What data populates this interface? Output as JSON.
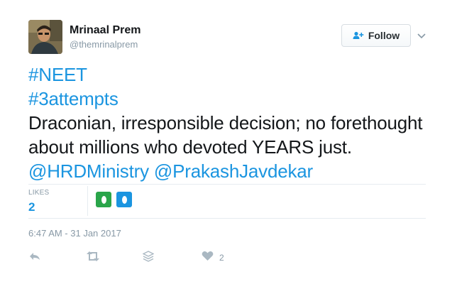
{
  "author": {
    "name": "Mrinaal Prem",
    "handle": "@themrinalprem",
    "avatar_icon": "user-avatar-photo"
  },
  "follow_button": {
    "label": "Follow",
    "icon": "add-user-icon"
  },
  "tweet": {
    "hashtag_1": "#NEET",
    "hashtag_2": "#3attempts",
    "text_line_1": "Draconian, irresponsible decision; no forethought",
    "text_line_2": "about millions who devoted YEARS just.",
    "mention_1": "@HRDMinistry",
    "mention_2": "@PrakashJavdekar"
  },
  "stats": {
    "likes_label": "LIKES",
    "likes_count": "2",
    "likers": [
      {
        "icon": "default-egg-avatar",
        "color": "#2aa54a"
      },
      {
        "icon": "default-egg-avatar",
        "color": "#1b95e0"
      }
    ]
  },
  "timestamp": "6:47 AM - 31 Jan 2017",
  "actions": {
    "reply_icon": "reply-icon",
    "retweet_icon": "retweet-icon",
    "more_icon": "layers-icon",
    "like_icon": "heart-icon",
    "like_count": "2"
  },
  "colors": {
    "link": "#1b95e0",
    "muted": "#8899a6",
    "text": "#14171a",
    "divider": "#e6ecf0"
  }
}
